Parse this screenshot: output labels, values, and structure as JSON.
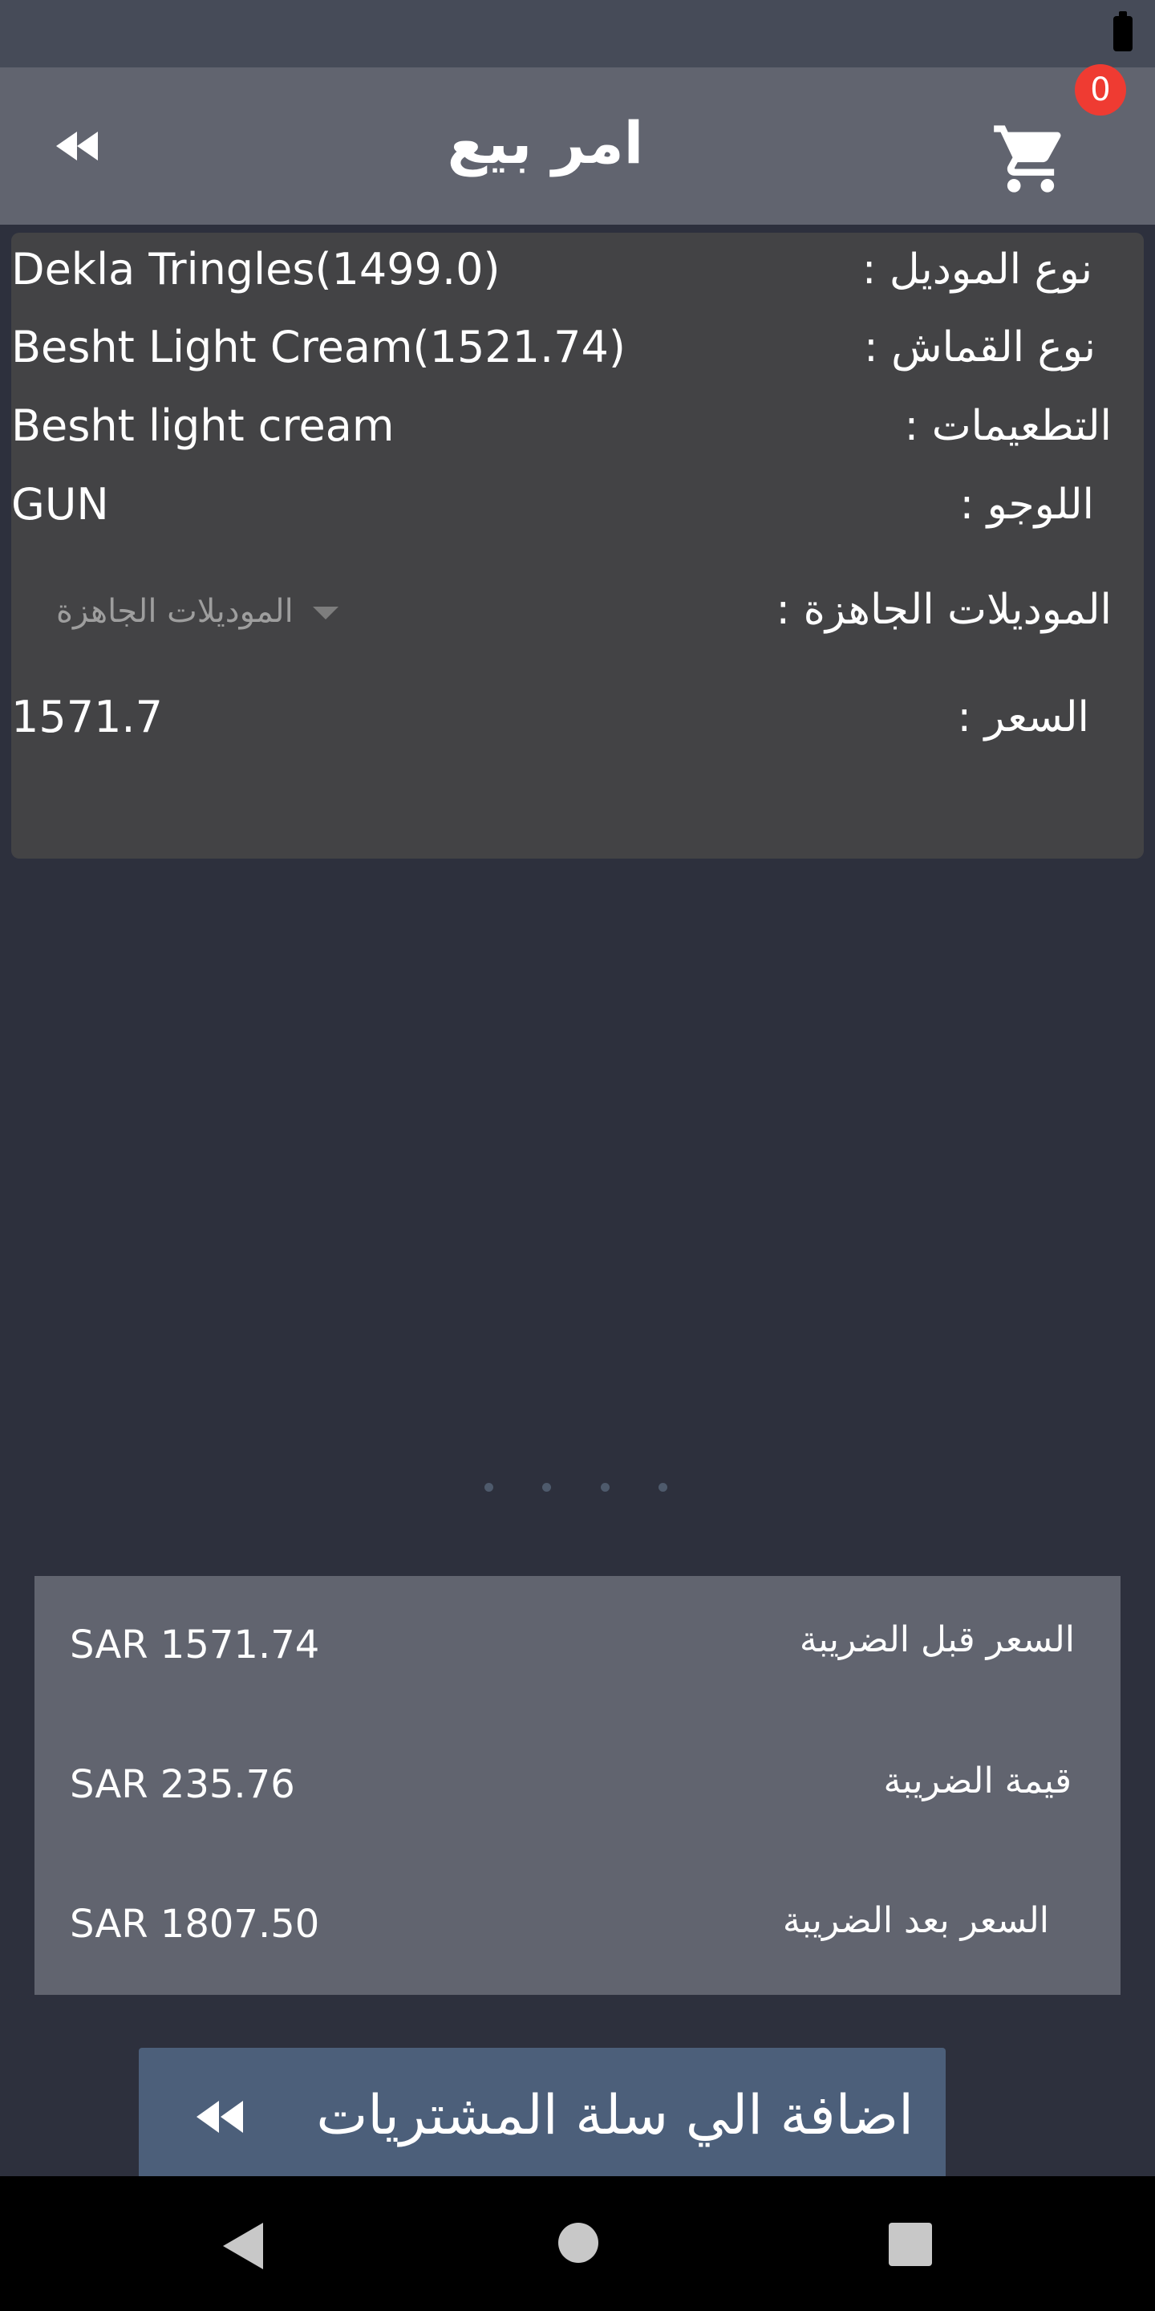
{
  "app_bar": {
    "title": "امر بيع",
    "cart_count": "0",
    "back_icon": "double-chevron-left-icon",
    "cart_icon": "shopping-cart-icon"
  },
  "details": {
    "model_type": {
      "label": "نوع الموديل :",
      "value": "Dekla Tringles(1499.0)"
    },
    "fabric_type": {
      "label": "نوع القماش :",
      "value": "Besht Light Cream(1521.74)"
    },
    "embellishments": {
      "label": "التطعيمات :",
      "value": "Besht light cream"
    },
    "logo": {
      "label": "اللوجو :",
      "value": "GUN"
    },
    "ready_models": {
      "label": "الموديلات الجاهزة :",
      "placeholder": "الموديلات الجاهزة"
    },
    "price": {
      "label": "السعر  :",
      "value": "1571.7"
    }
  },
  "pager": {
    "dots": 4
  },
  "totals": {
    "before_tax": {
      "label": "السعر قبل الضريبة",
      "value": "SAR 1571.74"
    },
    "tax": {
      "label": "قيمة الضريبة",
      "value": "SAR 235.76"
    },
    "after_tax": {
      "label": "السعر بعد الضريبة",
      "value": "SAR 1807.50"
    }
  },
  "add_to_cart": {
    "label": "اضافة الي سلة المشتريات"
  },
  "colors": {
    "background": "#2d303d",
    "app_bar": "#61646f",
    "card": "#434345",
    "badge": "#ef3b32",
    "button": "#4c5f7a"
  }
}
